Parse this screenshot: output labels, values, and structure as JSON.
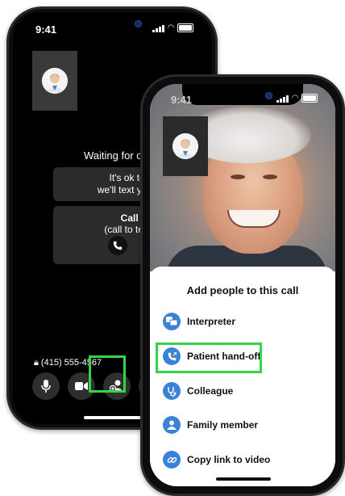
{
  "status": {
    "time": "9:41"
  },
  "call_screen": {
    "waiting_text": "Waiting for others",
    "hangup_line1": "It's ok to hang up",
    "hangup_line2": "we'll text you when the",
    "nudge_title": "Call Nudge",
    "nudge_sub": "(call to tell them to j",
    "phone_number": "(415) 555-4567"
  },
  "add_people": {
    "title": "Add people to this call",
    "options": [
      {
        "label": "Interpreter",
        "icon": "interpreter-icon"
      },
      {
        "label": "Patient hand-off",
        "icon": "phone-transfer-icon"
      },
      {
        "label": "Colleague",
        "icon": "stethoscope-icon"
      },
      {
        "label": "Family member",
        "icon": "person-icon"
      },
      {
        "label": "Copy link to video",
        "icon": "link-icon"
      }
    ]
  },
  "colors": {
    "highlight": "#36d348",
    "accent": "#3b82d6"
  }
}
